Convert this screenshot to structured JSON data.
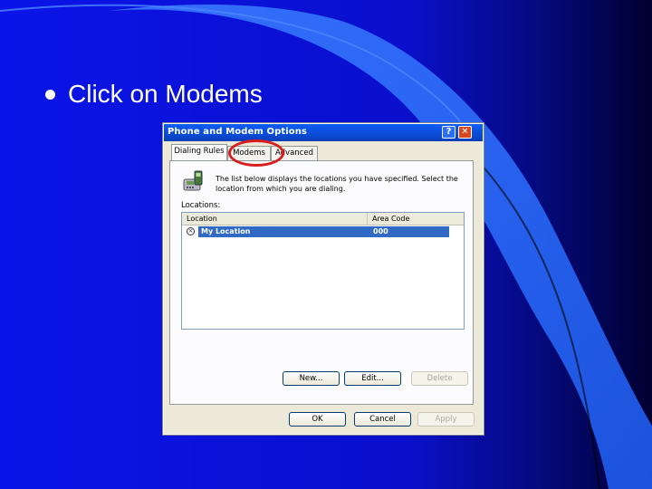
{
  "slide": {
    "bullet_text": "Click on Modems",
    "colors": {
      "background": "#0a14e0",
      "accent_light": "#2f6bff",
      "dark": "#000040",
      "annotation": "#d81e1e"
    }
  },
  "dialog": {
    "title": "Phone and Modem Options",
    "title_buttons": {
      "help": "?",
      "close": "✕"
    },
    "tabs": [
      {
        "label": "Dialing Rules"
      },
      {
        "label": "Modems"
      },
      {
        "label": "Advanced"
      }
    ],
    "description": "The list below displays the locations you have specified. Select the location from which you are dialing.",
    "locations_label": "Locations:",
    "table": {
      "headers": [
        "Location",
        "Area Code"
      ],
      "rows": [
        {
          "location": "My Location",
          "area_code": "000"
        }
      ]
    },
    "buttons": {
      "new": "New...",
      "edit": "Edit...",
      "delete": "Delete",
      "ok": "OK",
      "cancel": "Cancel",
      "apply": "Apply"
    },
    "icons": {
      "phone": "phone-icon",
      "selected_location": "location-marker-icon"
    }
  }
}
